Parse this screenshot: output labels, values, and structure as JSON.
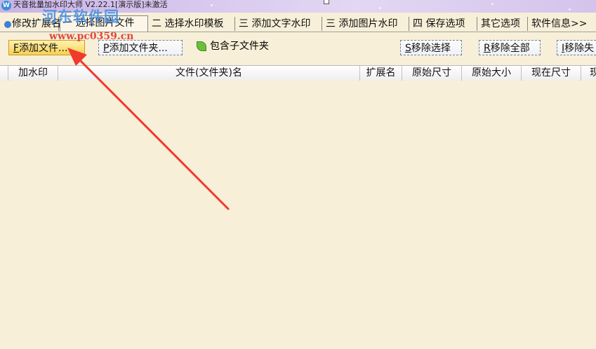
{
  "window": {
    "title": "天音批量加水印大师 V2.22.1[演示版]未激活",
    "icon": "app-logo-icon"
  },
  "watermark": {
    "site_name": "河东软件园",
    "site_url": "www.pc0359.cn"
  },
  "tabs": [
    {
      "label": "修改扩展名"
    },
    {
      "label": "一 选择图片文件",
      "active": true
    },
    {
      "label": "二 选择水印模板"
    },
    {
      "label": "三 添加文字水印"
    },
    {
      "label": "三 添加图片水印"
    },
    {
      "label": "四 保存选项"
    },
    {
      "label": "其它选项"
    },
    {
      "label": "软件信息>>"
    }
  ],
  "toolbar": {
    "add_file_key": "F",
    "add_file_label": "添加文件...",
    "add_folder_key": "P",
    "add_folder_label": "添加文件夹...",
    "include_subfolders_label": "包含子文件夹",
    "remove_selected_key": "S",
    "remove_selected_label": "移除选择",
    "remove_all_key": "R",
    "remove_all_label": "移除全部",
    "remove_watermarked_key": "I",
    "remove_watermarked_label": "移除失"
  },
  "table": {
    "columns": [
      "加水印",
      "文件(文件夹)名",
      "扩展名",
      "原始尺寸",
      "原始大小",
      "现在尺寸",
      "现"
    ]
  },
  "colors": {
    "background": "#f8efd8",
    "annotation_arrow": "#f03a2e",
    "primary_button": "#f8cf52"
  }
}
